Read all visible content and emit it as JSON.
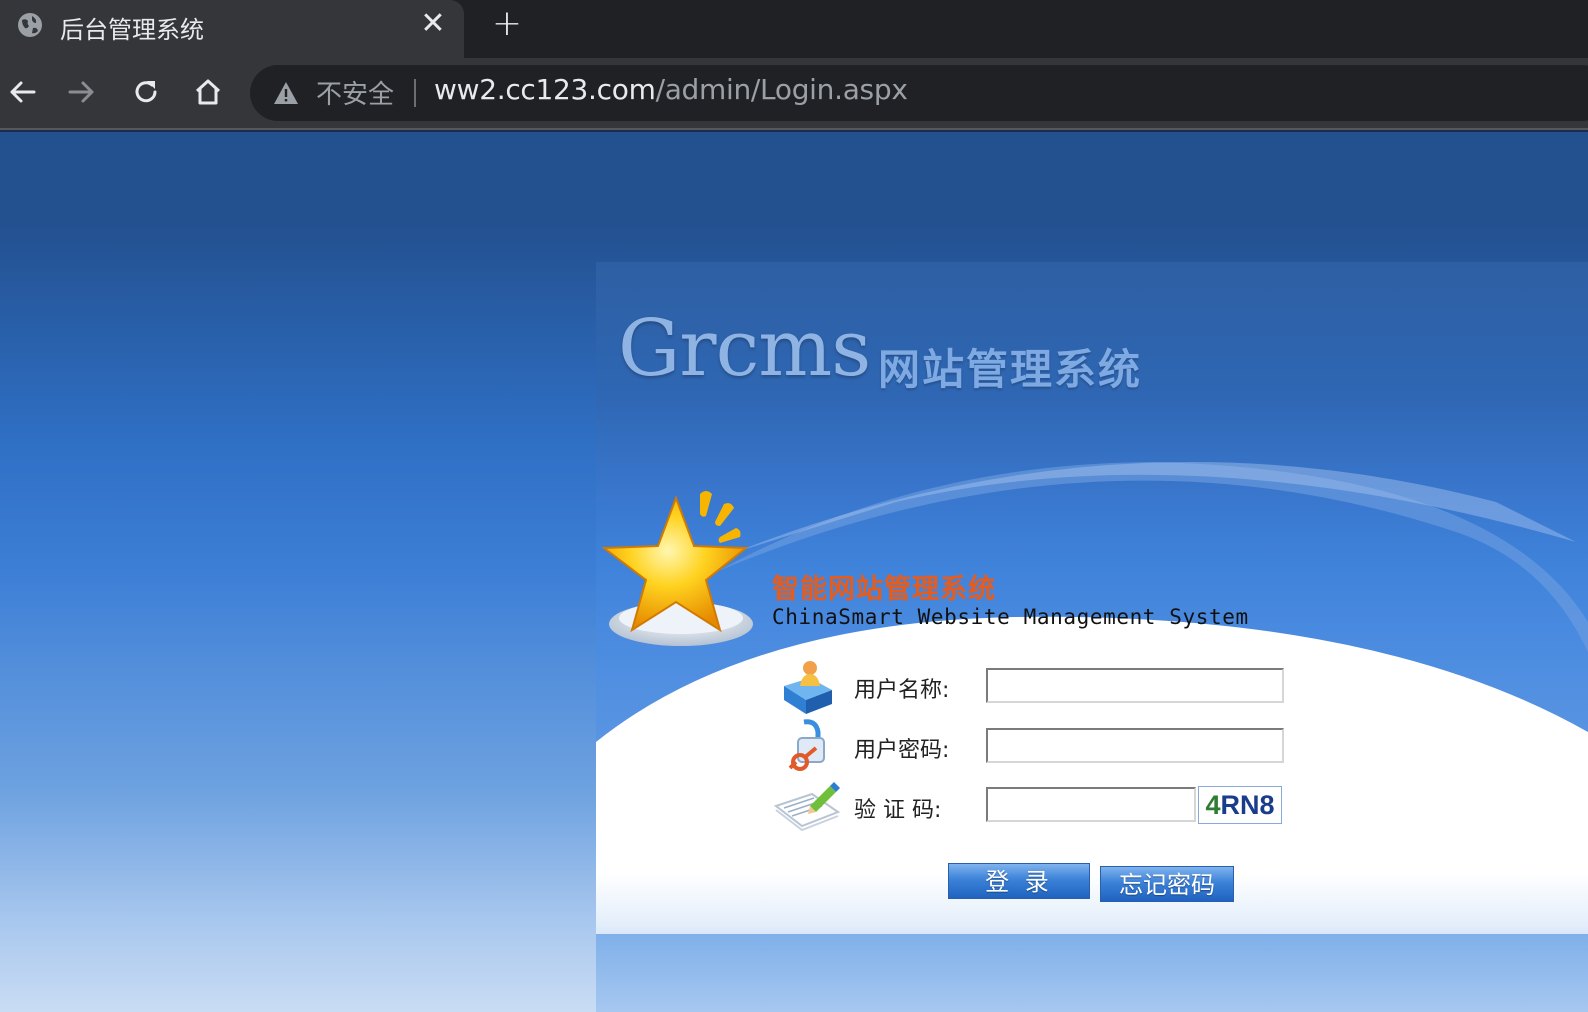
{
  "browser": {
    "tab_title": "后台管理系统",
    "security_label": "不安全",
    "url_host": "ww2.cc123.com",
    "url_path": "/admin/Login.aspx"
  },
  "login": {
    "brand_latin": "Grcms",
    "brand_cn": "网站管理系统",
    "system_cn": "智能网站管理系统",
    "system_en": "ChinaSmart Website Management System",
    "username_label": "用户名称:",
    "password_label": "用户密码:",
    "captcha_label": "验 证 码:",
    "captcha_first": "4",
    "captcha_rest": "RN8",
    "login_button": "登 录",
    "forgot_button": "忘记密码"
  },
  "icons": [
    "globe-icon",
    "close-icon",
    "plus-icon",
    "back-arrow-icon",
    "forward-arrow-icon",
    "reload-icon",
    "home-icon",
    "warning-icon",
    "star-icon",
    "user-icon",
    "lock-icon",
    "pencil-icon"
  ],
  "colors": {
    "page_blue": "#3d7fd6",
    "accent_orange": "#e65c1c",
    "button_blue": "#3c82d8"
  }
}
